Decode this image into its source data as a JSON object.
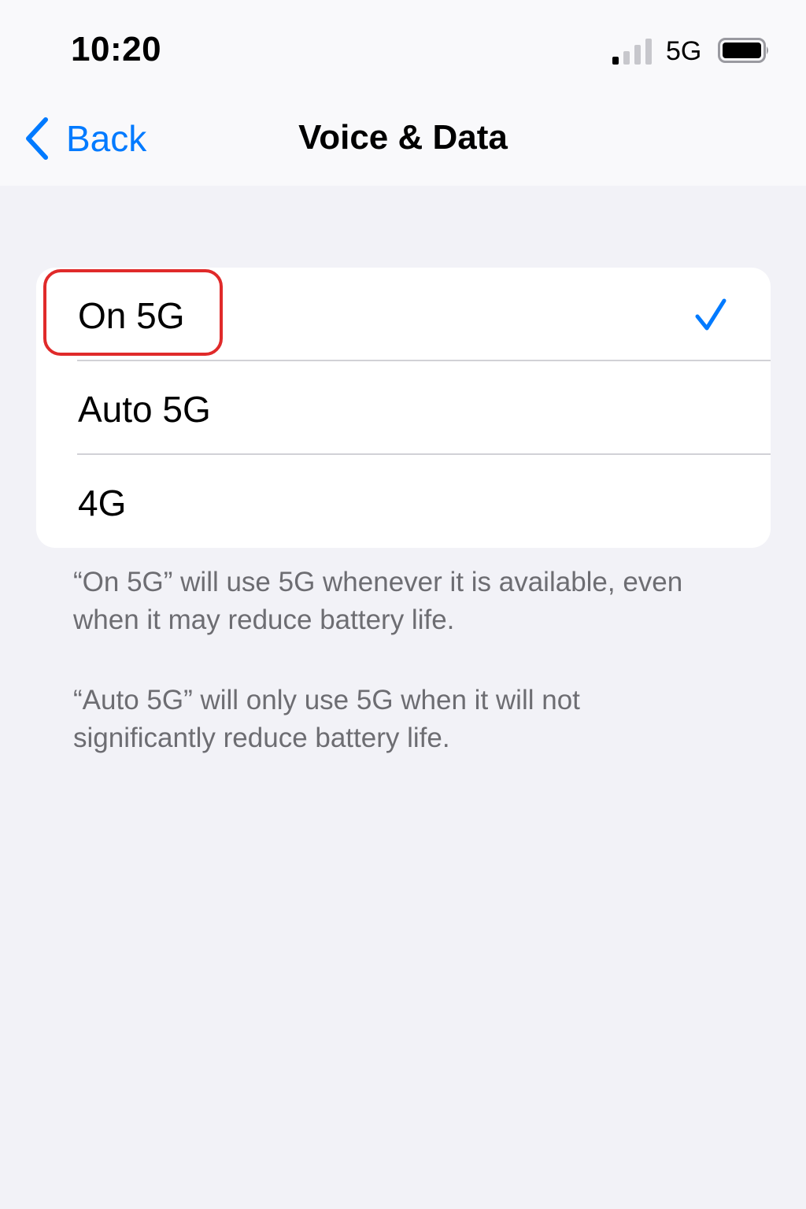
{
  "status_bar": {
    "time": "10:20",
    "signal_bars_filled": 1,
    "signal_bars_total": 4,
    "network": "5G",
    "battery_level": 1.0
  },
  "nav": {
    "back_label": "Back",
    "title": "Voice & Data"
  },
  "options": [
    {
      "label": "On 5G",
      "selected": true
    },
    {
      "label": "Auto 5G",
      "selected": false
    },
    {
      "label": "4G",
      "selected": false
    }
  ],
  "footer_notes": [
    "“On 5G” will use 5G whenever it is available, even when it may reduce battery life.",
    "“Auto 5G” will only use 5G when it will not significantly reduce battery life."
  ],
  "colors": {
    "accent": "#007aff",
    "highlight": "#e02a2a",
    "background": "#f2f2f7",
    "secondary_text": "#6d6d72"
  },
  "icons": {
    "back": "chevron-left-icon",
    "selected": "checkmark-icon",
    "signal": "signal-icon",
    "battery": "battery-icon"
  }
}
